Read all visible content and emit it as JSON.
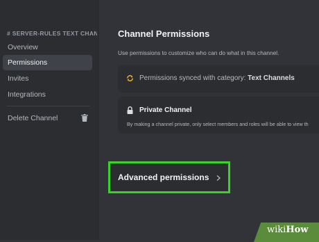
{
  "sidebar": {
    "header": "# SERVER-RULES TEXT CHANN",
    "items": [
      {
        "label": "Overview"
      },
      {
        "label": "Permissions"
      },
      {
        "label": "Invites"
      },
      {
        "label": "Integrations"
      }
    ],
    "delete_label": "Delete Channel"
  },
  "main": {
    "title": "Channel Permissions",
    "subtitle": "Use permissions to customize who can do what in this channel.",
    "sync": {
      "prefix": "Permissions synced with category: ",
      "category": "Text Channels"
    },
    "private": {
      "title": "Private Channel",
      "description": "By making a channel private, only select members and roles will be able to view th"
    },
    "advanced_label": "Advanced permissions"
  },
  "watermark": {
    "wiki": "wiki",
    "how": "How"
  },
  "colors": {
    "highlight": "#3cd327",
    "sync_icon": "#f0b232",
    "watermark_bg": "#5a8c3c"
  }
}
